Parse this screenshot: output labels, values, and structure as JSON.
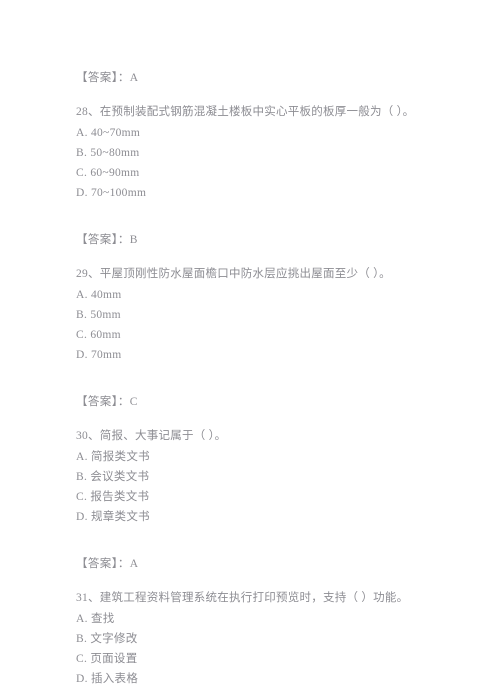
{
  "document": {
    "type": "exam-question-sheet",
    "text_color": "#8d8d93",
    "background_color": "#ffffff",
    "blocks": [
      {
        "answer": "【答案】：A"
      },
      {
        "question": "28、在预制装配式钢筋混凝土楼板中实心平板的板厚一般为（  ）。",
        "options": [
          "A. 40~70mm",
          "B. 50~80mm",
          "C. 60~90mm",
          "D. 70~100mm"
        ]
      },
      {
        "answer": "【答案】：B"
      },
      {
        "question": "29、平屋顶刚性防水屋面檐口中防水层应挑出屋面至少（  ）。",
        "options": [
          "A. 40mm",
          "B. 50mm",
          "C. 60mm",
          "D. 70mm"
        ]
      },
      {
        "answer": "【答案】：C"
      },
      {
        "question": "30、简报、大事记属于（  ）。",
        "options": [
          "A. 简报类文书",
          "B. 会议类文书",
          "C. 报告类文书",
          "D. 规章类文书"
        ]
      },
      {
        "answer": "【答案】：A"
      },
      {
        "question": "31、建筑工程资料管理系统在执行打印预览时，支持（  ）功能。",
        "options": [
          "A. 查找",
          "B. 文字修改",
          "C. 页面设置",
          "D. 插入表格"
        ]
      }
    ]
  }
}
